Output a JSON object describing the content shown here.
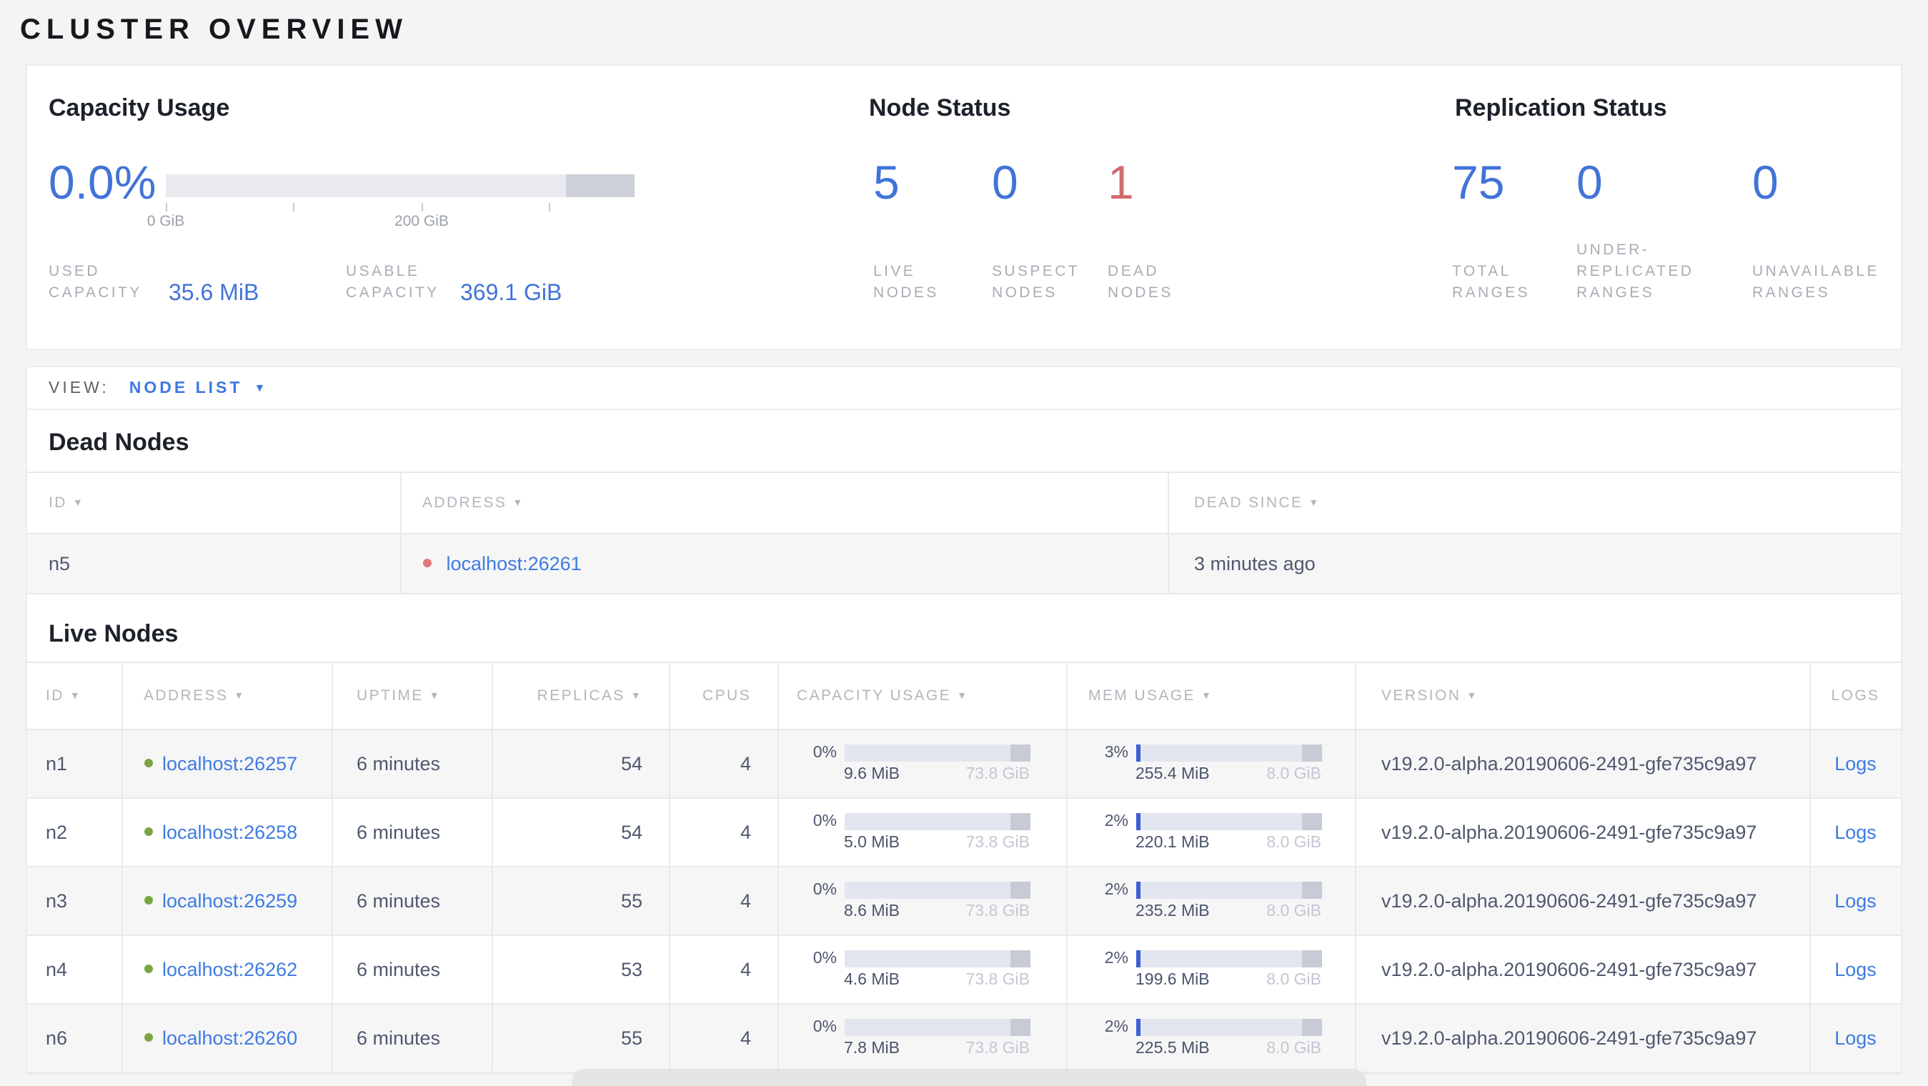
{
  "colors": {
    "accent_blue": "#4173d8",
    "link_blue": "#3e7be2",
    "danger_red": "#d36b70",
    "live_green": "#7aa642",
    "dead_red": "#e0787c"
  },
  "icons": {
    "sort_desc": "▼",
    "dropdown_caret": "▼"
  },
  "page": {
    "title": "CLUSTER OVERVIEW"
  },
  "summary": {
    "capacity": {
      "title": "Capacity Usage",
      "percent": "0.0%",
      "axis": {
        "tick_start": "0 GiB",
        "tick_mid": "200 GiB"
      },
      "used_label_lines": [
        "USED",
        "CAPACITY"
      ],
      "used_value": "35.6 MiB",
      "usable_label_lines": [
        "USABLE",
        "CAPACITY"
      ],
      "usable_value": "369.1 GiB"
    },
    "node_status": {
      "title": "Node Status",
      "stats": [
        {
          "value": "5",
          "label_lines": [
            "LIVE",
            "NODES"
          ]
        },
        {
          "value": "0",
          "label_lines": [
            "SUSPECT",
            "NODES"
          ]
        },
        {
          "value": "1",
          "label_lines": [
            "DEAD",
            "NODES"
          ]
        }
      ]
    },
    "replication": {
      "title": "Replication Status",
      "stats": [
        {
          "value": "75",
          "label_lines": [
            "TOTAL",
            "RANGES"
          ]
        },
        {
          "value": "0",
          "label_lines": [
            "UNDER-",
            "REPLICATED",
            "RANGES"
          ]
        },
        {
          "value": "0",
          "label_lines": [
            "UNAVAILABLE",
            "RANGES"
          ]
        }
      ]
    }
  },
  "view_bar": {
    "label": "VIEW:",
    "selected": "NODE LIST"
  },
  "dead_nodes": {
    "heading": "Dead Nodes",
    "columns": [
      "ID",
      "ADDRESS",
      "DEAD SINCE"
    ],
    "rows": [
      {
        "id": "n5",
        "address": "localhost:26261",
        "dead_since": "3 minutes ago"
      }
    ]
  },
  "live_nodes": {
    "heading": "Live Nodes",
    "columns": [
      "ID",
      "ADDRESS",
      "UPTIME",
      "REPLICAS",
      "CPUS",
      "CAPACITY USAGE",
      "MEM USAGE",
      "VERSION",
      "LOGS"
    ],
    "logs_label": "Logs",
    "rows": [
      {
        "id": "n1",
        "address": "localhost:26257",
        "uptime": "6 minutes",
        "replicas": "54",
        "cpus": "4",
        "capacity": {
          "pct": "0%",
          "pct_num": 0,
          "used": "9.6 MiB",
          "total": "73.8 GiB"
        },
        "mem": {
          "pct": "3%",
          "pct_num": 3,
          "used": "255.4 MiB",
          "total": "8.0 GiB"
        },
        "version": "v19.2.0-alpha.20190606-2491-gfe735c9a97"
      },
      {
        "id": "n2",
        "address": "localhost:26258",
        "uptime": "6 minutes",
        "replicas": "54",
        "cpus": "4",
        "capacity": {
          "pct": "0%",
          "pct_num": 0,
          "used": "5.0 MiB",
          "total": "73.8 GiB"
        },
        "mem": {
          "pct": "2%",
          "pct_num": 2,
          "used": "220.1 MiB",
          "total": "8.0 GiB"
        },
        "version": "v19.2.0-alpha.20190606-2491-gfe735c9a97"
      },
      {
        "id": "n3",
        "address": "localhost:26259",
        "uptime": "6 minutes",
        "replicas": "55",
        "cpus": "4",
        "capacity": {
          "pct": "0%",
          "pct_num": 0,
          "used": "8.6 MiB",
          "total": "73.8 GiB"
        },
        "mem": {
          "pct": "2%",
          "pct_num": 2,
          "used": "235.2 MiB",
          "total": "8.0 GiB"
        },
        "version": "v19.2.0-alpha.20190606-2491-gfe735c9a97"
      },
      {
        "id": "n4",
        "address": "localhost:26262",
        "uptime": "6 minutes",
        "replicas": "53",
        "cpus": "4",
        "capacity": {
          "pct": "0%",
          "pct_num": 0,
          "used": "4.6 MiB",
          "total": "73.8 GiB"
        },
        "mem": {
          "pct": "2%",
          "pct_num": 2,
          "used": "199.6 MiB",
          "total": "8.0 GiB"
        },
        "version": "v19.2.0-alpha.20190606-2491-gfe735c9a97"
      },
      {
        "id": "n6",
        "address": "localhost:26260",
        "uptime": "6 minutes",
        "replicas": "55",
        "cpus": "4",
        "capacity": {
          "pct": "0%",
          "pct_num": 0,
          "used": "7.8 MiB",
          "total": "73.8 GiB"
        },
        "mem": {
          "pct": "2%",
          "pct_num": 2,
          "used": "225.5 MiB",
          "total": "8.0 GiB"
        },
        "version": "v19.2.0-alpha.20190606-2491-gfe735c9a97"
      }
    ]
  }
}
